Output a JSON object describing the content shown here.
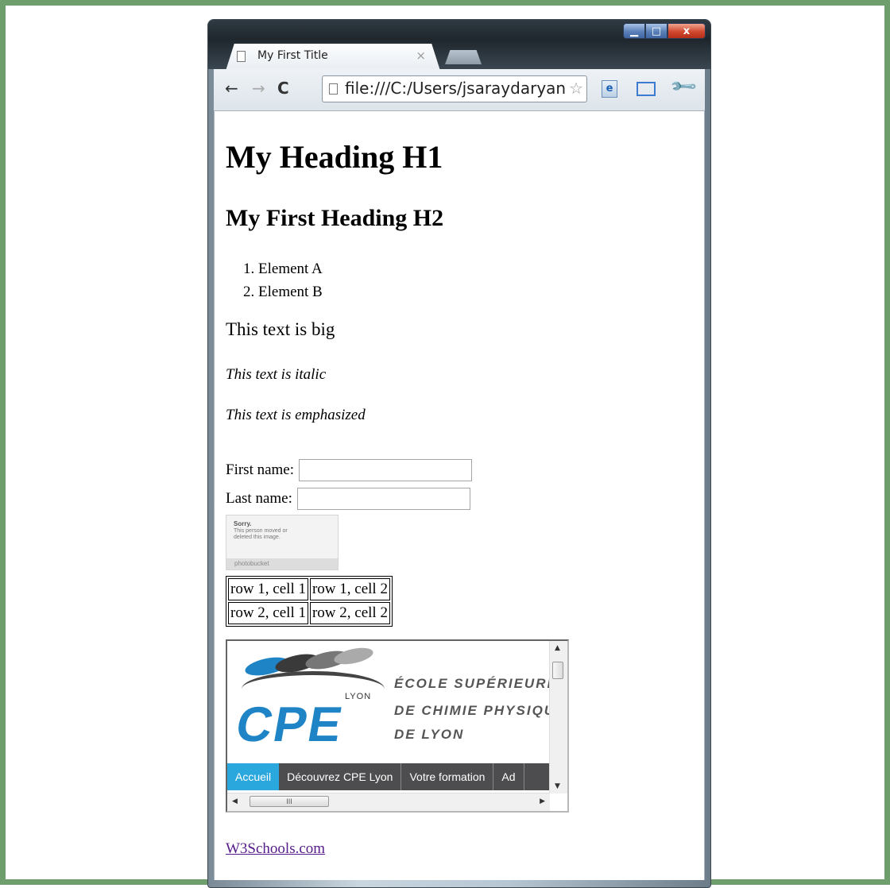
{
  "window": {
    "tab_title": "My First Title",
    "tab_close": "×",
    "controls": {
      "minimize": "▁",
      "maximize": "□",
      "close": "x"
    }
  },
  "toolbar": {
    "back": "←",
    "forward": "→",
    "reload": "C",
    "url": "file:///C:/Users/jsaraydaryan",
    "star": "☆",
    "ie_label": "e",
    "wrench": "🔧"
  },
  "page": {
    "h1": "My Heading H1",
    "h2": "My First Heading H2",
    "list": [
      "1. Element A",
      "2. Element B"
    ],
    "big_text": "This text is big",
    "italic_text": "This text is italic",
    "em_text": "This text is emphasized",
    "form": {
      "first_label": "First name:",
      "last_label": "Last name:",
      "first_value": "",
      "last_value": ""
    },
    "image": {
      "sorry": "Sorry.",
      "message": "This person moved or deleted this image.",
      "footer": "photobucket"
    },
    "table": {
      "rows": [
        [
          "row 1, cell 1",
          "row 1, cell 2"
        ],
        [
          "row 2, cell 1",
          "row 2, cell 2"
        ]
      ]
    },
    "iframe": {
      "logo_text": "CPE",
      "logo_city": "LYON",
      "school_lines": [
        "ÉCOLE SUPÉRIEURE",
        "DE CHIMIE PHYSIQU",
        "DE LYON"
      ],
      "nav": [
        "Accueil",
        "Découvrez CPE Lyon",
        "Votre formation",
        "Ad"
      ],
      "scroll_arrows": {
        "up": "▲",
        "down": "▼",
        "left": "◀",
        "right": "▶"
      },
      "hthumb_grip": "III"
    },
    "link": "W3Schools.com"
  }
}
